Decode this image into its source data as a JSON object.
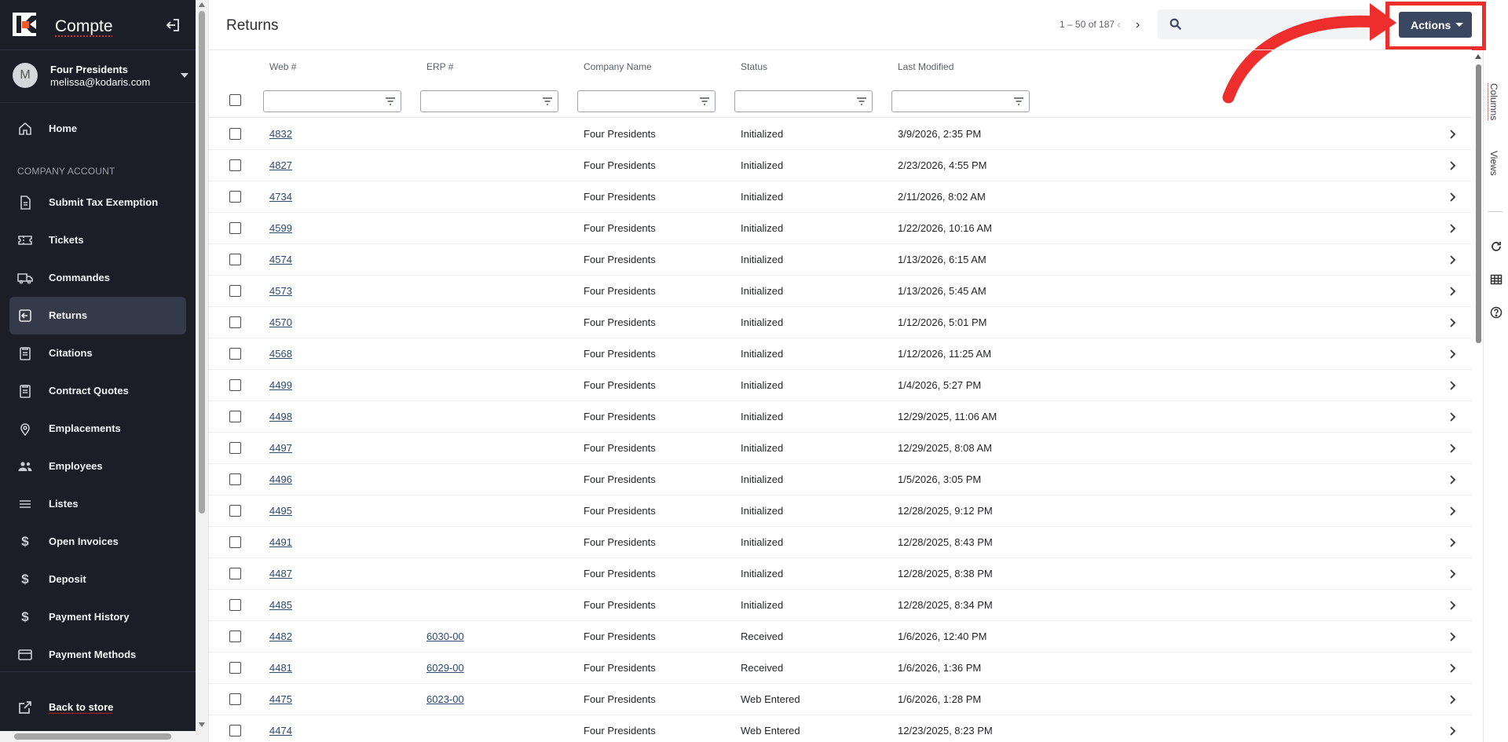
{
  "app": {
    "name": "Compte"
  },
  "account": {
    "initial": "M",
    "name": "Four Presidents",
    "email": "melissa@kodaris.com"
  },
  "nav": {
    "home": "Home",
    "section_label": "COMPANY ACCOUNT",
    "items": [
      {
        "label": "Submit Tax Exemption",
        "icon": "document-icon"
      },
      {
        "label": "Tickets",
        "icon": "ticket-icon"
      },
      {
        "label": "Commandes",
        "icon": "truck-icon"
      },
      {
        "label": "Returns",
        "icon": "return-icon",
        "active": true
      },
      {
        "label": "Citations",
        "icon": "clipboard-icon"
      },
      {
        "label": "Contract Quotes",
        "icon": "clipboard-icon"
      },
      {
        "label": "Emplacements",
        "icon": "location-pin-icon"
      },
      {
        "label": "Employees",
        "icon": "people-icon"
      },
      {
        "label": "Listes",
        "icon": "list-icon"
      },
      {
        "label": "Open Invoices",
        "icon": "dollar-icon"
      },
      {
        "label": "Deposit",
        "icon": "dollar-icon"
      },
      {
        "label": "Payment History",
        "icon": "dollar-icon"
      },
      {
        "label": "Payment Methods",
        "icon": "credit-card-icon"
      }
    ],
    "back_to_store": "Back to store"
  },
  "page": {
    "title": "Returns",
    "pager": "1 – 50 of 187",
    "search_placeholder": "",
    "actions_label": "Actions"
  },
  "grid": {
    "columns": [
      "Web #",
      "ERP #",
      "Company Name",
      "Status",
      "Last Modified"
    ],
    "rows": [
      {
        "web": "4832",
        "erp": "",
        "company": "Four Presidents",
        "status": "Initialized",
        "modified": "3/9/2026, 2:35 PM"
      },
      {
        "web": "4827",
        "erp": "",
        "company": "Four Presidents",
        "status": "Initialized",
        "modified": "2/23/2026, 4:55 PM"
      },
      {
        "web": "4734",
        "erp": "",
        "company": "Four Presidents",
        "status": "Initialized",
        "modified": "2/11/2026, 8:02 AM"
      },
      {
        "web": "4599",
        "erp": "",
        "company": "Four Presidents",
        "status": "Initialized",
        "modified": "1/22/2026, 10:16 AM"
      },
      {
        "web": "4574",
        "erp": "",
        "company": "Four Presidents",
        "status": "Initialized",
        "modified": "1/13/2026, 6:15 AM"
      },
      {
        "web": "4573",
        "erp": "",
        "company": "Four Presidents",
        "status": "Initialized",
        "modified": "1/13/2026, 5:45 AM"
      },
      {
        "web": "4570",
        "erp": "",
        "company": "Four Presidents",
        "status": "Initialized",
        "modified": "1/12/2026, 5:01 PM"
      },
      {
        "web": "4568",
        "erp": "",
        "company": "Four Presidents",
        "status": "Initialized",
        "modified": "1/12/2026, 11:25 AM"
      },
      {
        "web": "4499",
        "erp": "",
        "company": "Four Presidents",
        "status": "Initialized",
        "modified": "1/4/2026, 5:27 PM"
      },
      {
        "web": "4498",
        "erp": "",
        "company": "Four Presidents",
        "status": "Initialized",
        "modified": "12/29/2025, 11:06 AM"
      },
      {
        "web": "4497",
        "erp": "",
        "company": "Four Presidents",
        "status": "Initialized",
        "modified": "12/29/2025, 8:08 AM"
      },
      {
        "web": "4496",
        "erp": "",
        "company": "Four Presidents",
        "status": "Initialized",
        "modified": "1/5/2026, 3:05 PM"
      },
      {
        "web": "4495",
        "erp": "",
        "company": "Four Presidents",
        "status": "Initialized",
        "modified": "12/28/2025, 9:12 PM"
      },
      {
        "web": "4491",
        "erp": "",
        "company": "Four Presidents",
        "status": "Initialized",
        "modified": "12/28/2025, 8:43 PM"
      },
      {
        "web": "4487",
        "erp": "",
        "company": "Four Presidents",
        "status": "Initialized",
        "modified": "12/28/2025, 8:38 PM"
      },
      {
        "web": "4485",
        "erp": "",
        "company": "Four Presidents",
        "status": "Initialized",
        "modified": "12/28/2025, 8:34 PM"
      },
      {
        "web": "4482",
        "erp": "6030-00",
        "company": "Four Presidents",
        "status": "Received",
        "modified": "1/6/2026, 12:40 PM"
      },
      {
        "web": "4481",
        "erp": "6029-00",
        "company": "Four Presidents",
        "status": "Received",
        "modified": "1/6/2026, 1:36 PM"
      },
      {
        "web": "4475",
        "erp": "6023-00",
        "company": "Four Presidents",
        "status": "Web Entered",
        "modified": "1/6/2026, 1:28 PM"
      },
      {
        "web": "4474",
        "erp": "",
        "company": "Four Presidents",
        "status": "Web Entered",
        "modified": "12/23/2025, 8:23 PM"
      }
    ]
  },
  "side_panel": {
    "columns_tab": "Columns",
    "views_tab": "Views"
  },
  "colors": {
    "sidebar_bg": "#1b1e27",
    "active_nav_bg": "#353a49",
    "actions_bg": "#3b4660",
    "highlight": "#ee2d2d",
    "link": "#2a4a72"
  }
}
